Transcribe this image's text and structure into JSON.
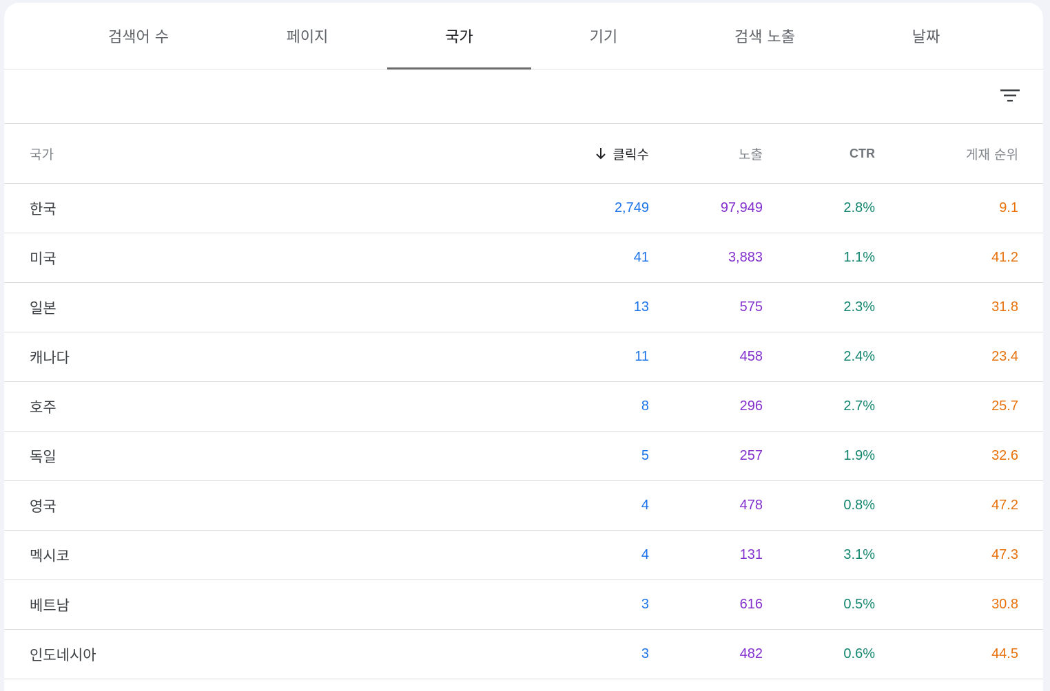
{
  "tabs": [
    {
      "label": "검색어 수",
      "active": false
    },
    {
      "label": "페이지",
      "active": false
    },
    {
      "label": "국가",
      "active": true
    },
    {
      "label": "기기",
      "active": false
    },
    {
      "label": "검색 노출",
      "active": false
    },
    {
      "label": "날짜",
      "active": false
    }
  ],
  "toolbar": {
    "filter_icon": "filter-list-icon"
  },
  "table": {
    "headers": {
      "country": "국가",
      "clicks": "클릭수",
      "impressions": "노출",
      "ctr": "CTR",
      "position": "게재 순위"
    },
    "sort_icon": "arrow-down-icon",
    "rows": [
      {
        "country": "한국",
        "clicks": "2,749",
        "impressions": "97,949",
        "ctr": "2.8%",
        "position": "9.1"
      },
      {
        "country": "미국",
        "clicks": "41",
        "impressions": "3,883",
        "ctr": "1.1%",
        "position": "41.2"
      },
      {
        "country": "일본",
        "clicks": "13",
        "impressions": "575",
        "ctr": "2.3%",
        "position": "31.8"
      },
      {
        "country": "캐나다",
        "clicks": "11",
        "impressions": "458",
        "ctr": "2.4%",
        "position": "23.4"
      },
      {
        "country": "호주",
        "clicks": "8",
        "impressions": "296",
        "ctr": "2.7%",
        "position": "25.7"
      },
      {
        "country": "독일",
        "clicks": "5",
        "impressions": "257",
        "ctr": "1.9%",
        "position": "32.6"
      },
      {
        "country": "영국",
        "clicks": "4",
        "impressions": "478",
        "ctr": "0.8%",
        "position": "47.2"
      },
      {
        "country": "멕시코",
        "clicks": "4",
        "impressions": "131",
        "ctr": "3.1%",
        "position": "47.3"
      },
      {
        "country": "베트남",
        "clicks": "3",
        "impressions": "616",
        "ctr": "0.5%",
        "position": "30.8"
      },
      {
        "country": "인도네시아",
        "clicks": "3",
        "impressions": "482",
        "ctr": "0.6%",
        "position": "44.5"
      }
    ]
  },
  "colors": {
    "clicks": "#1a73e8",
    "impressions": "#8430ce",
    "ctr": "#12856e",
    "position": "#e8710a",
    "active_tab_indicator": "#6a6a6a"
  }
}
